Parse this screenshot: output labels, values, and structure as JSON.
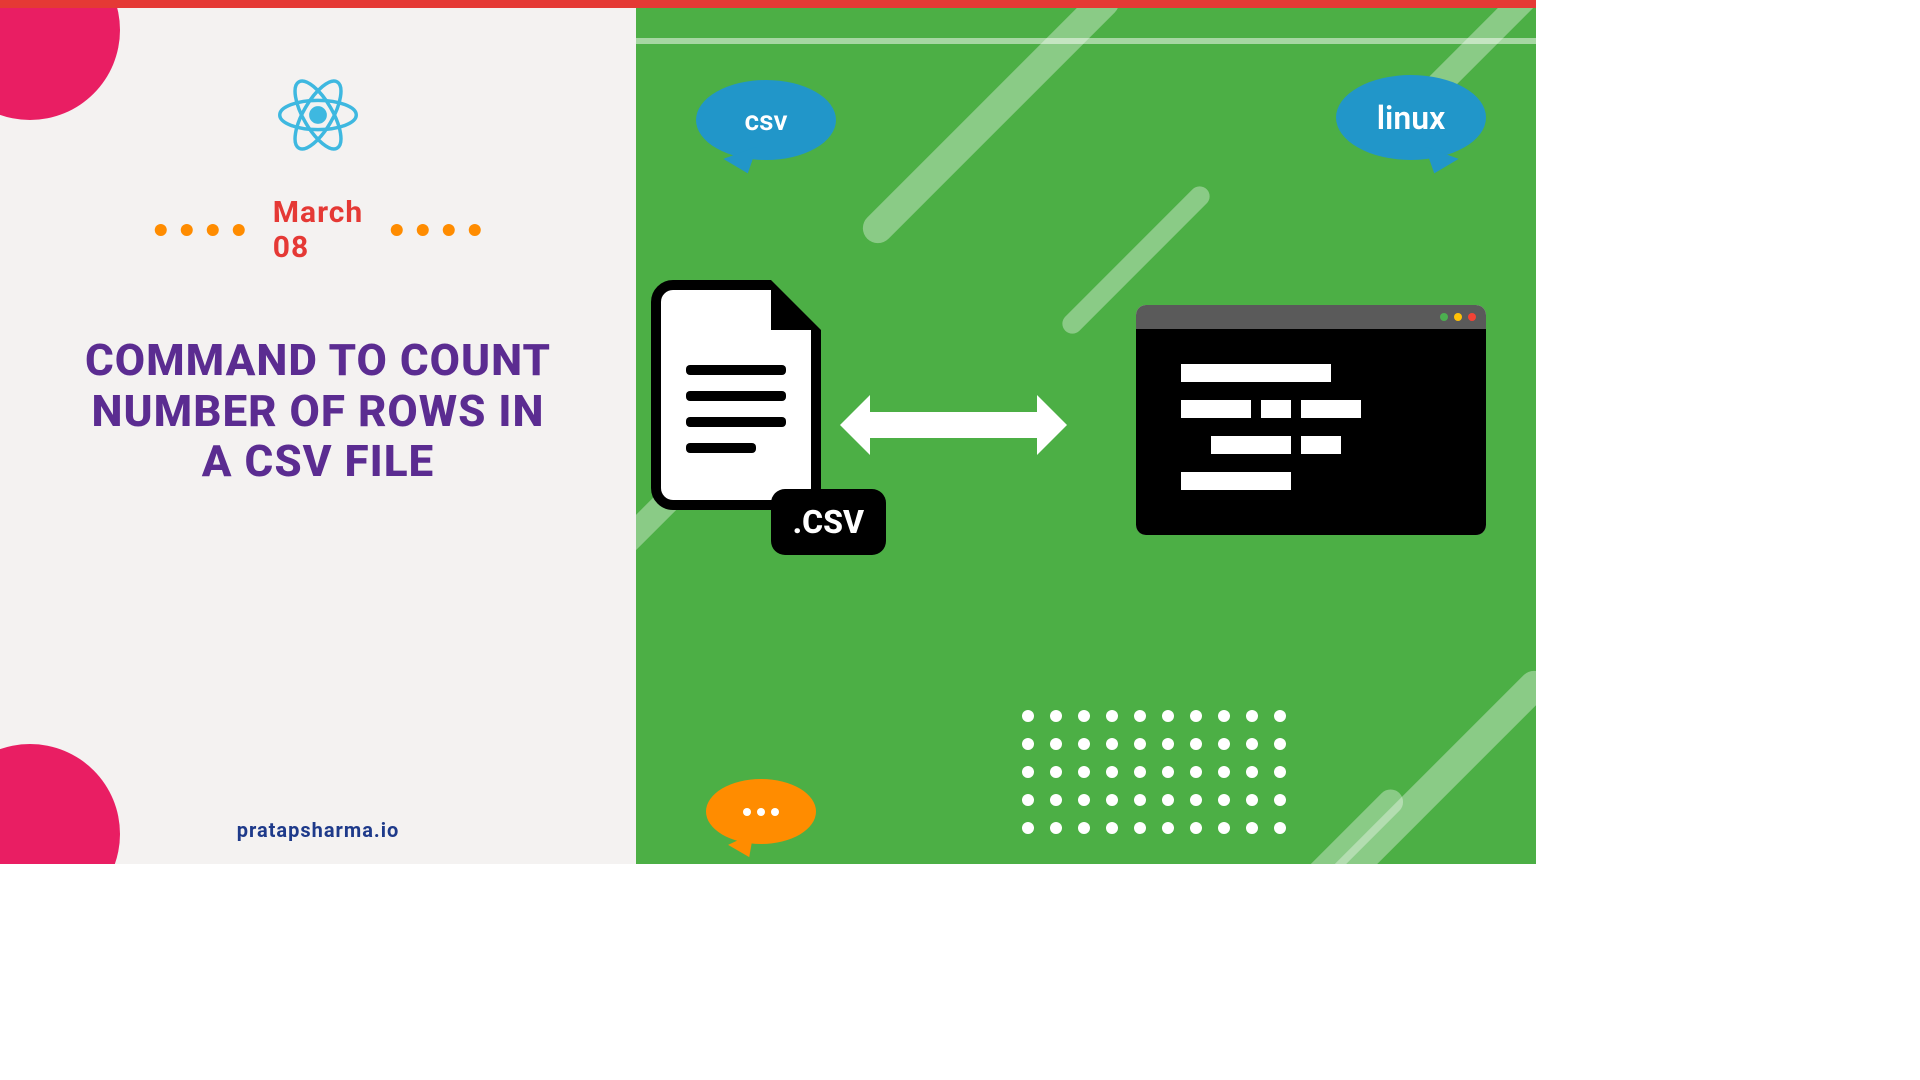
{
  "date_label": "March 08",
  "title": "COMMAND TO COUNT NUMBER OF ROWS IN A CSV FILE",
  "site_url": "pratapsharma.io",
  "tags": {
    "csv": "csv",
    "linux": "linux"
  },
  "file_ext_label": ".CSV",
  "colors": {
    "accent_pink": "#e91e63",
    "accent_red": "#e53935",
    "accent_orange": "#ff8c00",
    "accent_purple": "#5b2c91",
    "accent_blue": "#2196c9",
    "accent_green": "#4caf45",
    "react_cyan": "#3eb8e0"
  }
}
